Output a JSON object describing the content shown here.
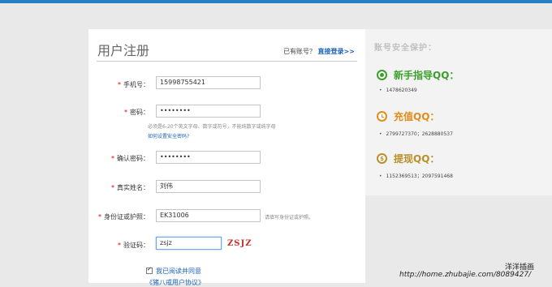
{
  "header": {
    "title": "用户注册",
    "has_account": "已有账号？",
    "login_link": "直接登录>>"
  },
  "form": {
    "phone": {
      "label": "手机号：",
      "value": "15998755421"
    },
    "password": {
      "label": "密码：",
      "value": "••••••••",
      "hint": "必须是6-20个英文字母、数字或符号，不能纯数字或纯字母",
      "help_link": "如何设置安全密码?"
    },
    "confirm_password": {
      "label": "确认密码：",
      "value": "••••••••"
    },
    "real_name": {
      "label": "真实姓名：",
      "value": "刘伟"
    },
    "id_number": {
      "label": "身份证或护照：",
      "value": "EK31006",
      "hint": "请填写身份证或护照。"
    },
    "captcha": {
      "label": "验证码：",
      "value": "zsjz",
      "image_text": "ZSJZ"
    },
    "agree": {
      "checked": true,
      "label": "我已阅读并同意",
      "link": "《猪八戒用户协议》"
    }
  },
  "sidebar": {
    "title": "账号安全保护：",
    "sections": [
      {
        "heading": "新手指导QQ：",
        "icon": "target-icon",
        "color": "#3aa02a",
        "items": [
          "1478620349"
        ]
      },
      {
        "heading": "充值QQ：",
        "icon": "clock-icon",
        "color": "#e48c1a",
        "items": [
          "2799727370；2628880537"
        ]
      },
      {
        "heading": "提现QQ：",
        "icon": "money-bag-icon",
        "color": "#b8902a",
        "items": [
          "1152369513；2097591468"
        ]
      }
    ]
  },
  "watermark": {
    "line1": "洋洋插画",
    "line2": "http://home.zhubajie.com/8089427/"
  }
}
